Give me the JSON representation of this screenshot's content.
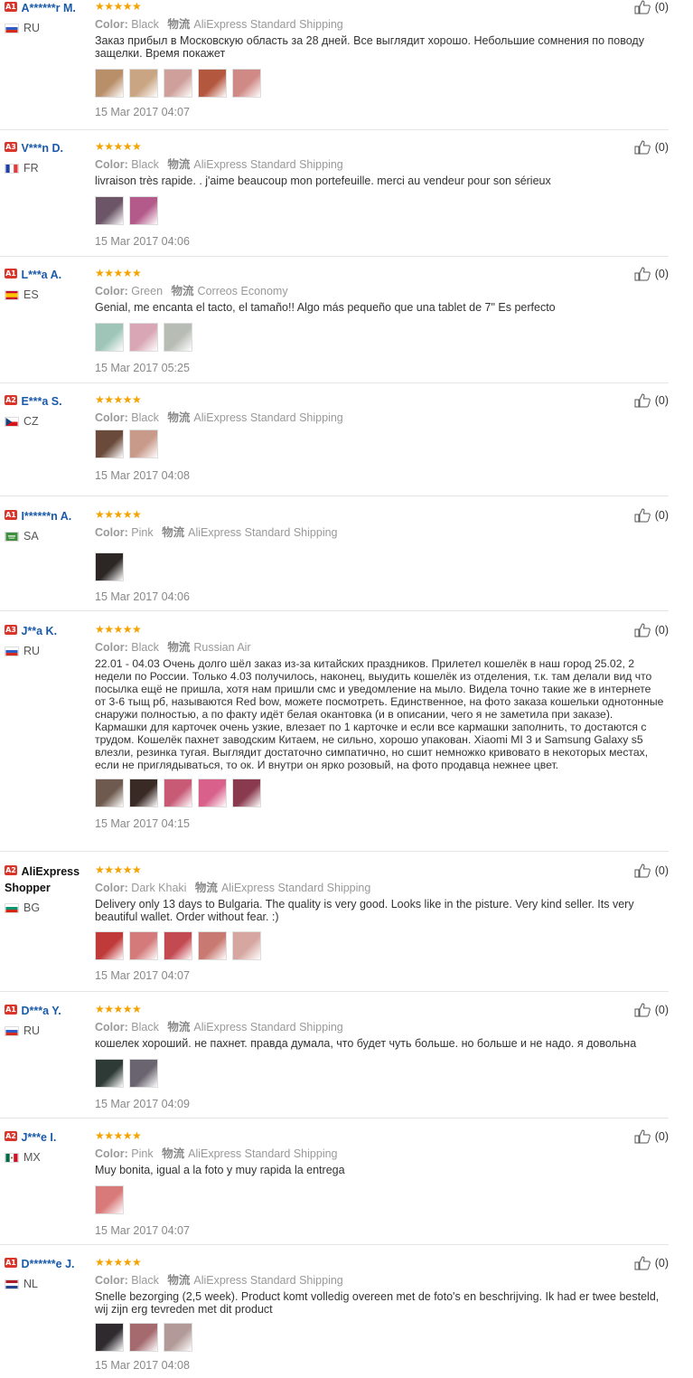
{
  "labels": {
    "color": "Color:",
    "shipping": "物流"
  },
  "reviews": [
    {
      "level": "A1",
      "name": "A******r M.",
      "country": "RU",
      "stars": "★★★★★",
      "color": "Black",
      "shipping": "AliExpress Standard Shipping",
      "text": "Заказ прибыл в Московскую область за 28 дней. Все выглядит хорошо. Небольшие сомнения по поводу защелки. Время покажет",
      "date": "15 Mar 2017 04:07",
      "helpful": "(0)",
      "thumbs": [
        "#b98f6a",
        "#c9a583",
        "#cfa09b",
        "#b4573f",
        "#d08a86"
      ]
    },
    {
      "level": "A3",
      "name": "V***n D.",
      "country": "FR",
      "stars": "★★★★★",
      "color": "Black",
      "shipping": "AliExpress Standard Shipping",
      "text": "livraison très rapide. . j'aime beaucoup mon portefeuille. merci au vendeur pour son sérieux",
      "date": "15 Mar 2017 04:06",
      "helpful": "(0)",
      "thumbs": [
        "#6b5566",
        "#b35a8a"
      ]
    },
    {
      "level": "A1",
      "name": "L***a A.",
      "country": "ES",
      "stars": "★★★★★",
      "color": "Green",
      "shipping": "Correos Economy",
      "text": "Genial, me encanta el tacto, el tamaño!! Algo más pequeño que una tablet de 7\" Es perfecto",
      "date": "15 Mar 2017 05:25",
      "helpful": "(0)",
      "thumbs": [
        "#9fc5b9",
        "#d8a6b4",
        "#b7bcb4"
      ]
    },
    {
      "level": "A2",
      "name": "E***a S.",
      "country": "CZ",
      "stars": "★★★★★",
      "color": "Black",
      "shipping": "AliExpress Standard Shipping",
      "text": "",
      "date": "15 Mar 2017 04:08",
      "helpful": "(0)",
      "thumbs": [
        "#6a4a3a",
        "#c89a8a"
      ]
    },
    {
      "level": "A1",
      "name": "I******n A.",
      "country": "SA",
      "stars": "★★★★★",
      "color": "Pink",
      "shipping": "AliExpress Standard Shipping",
      "text": "",
      "date": "15 Mar 2017 04:06",
      "helpful": "(0)",
      "thumbs": [
        "#2c2624"
      ]
    },
    {
      "level": "A3",
      "name": "J**a K.",
      "country": "RU",
      "stars": "★★★★★",
      "color": "Black",
      "shipping": "Russian Air",
      "text": "22.01 - 04.03 Очень долго шёл заказ из-за китайских праздников. Прилетел кошелёк в наш город 25.02, 2 недели по России. Только 4.03 получилось, наконец, выудить кошелёк из отделения, т.к. там делали вид что посылка ещё не пришла, хотя нам пришли смс и уведомление на мыло. Видела точно такие же в интернете от 3-6 тыщ рб, называются Red bow, можете посмотреть. Единственное, на фото заказа кошельки однотонные снаружи полностью, а по факту идёт белая окантовка (и в описании, чего я не заметила при заказе). Кармашки для карточек очень узкие, влезает по 1 карточке и если все кармашки заполнить, то достаются с трудом. Кошелёк пахнет заводским Китаем, не сильно, хорошо упакован. Xiaomi MI 3 и Samsung Galaxy s5 влезли, резинка тугая. Выглядит достаточно симпатично, но сшит немножко кривовато в некоторых местах, если не приглядываться, то ок. И внутри он ярко розовый, на фото продавца нежнее цвет.",
      "date": "15 Mar 2017 04:15",
      "helpful": "(0)",
      "thumbs": [
        "#6e5a4e",
        "#3a2a26",
        "#c85a76",
        "#d8608a",
        "#8a3a4e"
      ]
    },
    {
      "level": "A2",
      "name": "AliExpress Shopper",
      "country": "BG",
      "stars": "★★★★★",
      "color": "Dark Khaki",
      "shipping": "AliExpress Standard Shipping",
      "text": "Delivery only 13 days to Bulgaria. The quality is very good. Looks like in the pisture. Very kind seller. Its very beautiful wallet. Order without fear. :)",
      "date": "15 Mar 2017 04:07",
      "helpful": "(0)",
      "thumbs": [
        "#c03a3a",
        "#d47a7a",
        "#c44a52",
        "#c87a72",
        "#d6a6a0"
      ]
    },
    {
      "level": "A1",
      "name": "D***a Y.",
      "country": "RU",
      "stars": "★★★★★",
      "color": "Black",
      "shipping": "AliExpress Standard Shipping",
      "text": "кошелек хороший. не пахнет. правда думала, что будет чуть больше. но больше и не надо. я довольна",
      "date": "15 Mar 2017 04:09",
      "helpful": "(0)",
      "thumbs": [
        "#2e3a36",
        "#6a6470"
      ]
    },
    {
      "level": "A2",
      "name": "J***e I.",
      "country": "MX",
      "stars": "★★★★★",
      "color": "Pink",
      "shipping": "AliExpress Standard Shipping",
      "text": "Muy bonita, igual a la foto y muy rapida la entrega",
      "date": "15 Mar 2017 04:07",
      "helpful": "(0)",
      "thumbs": [
        "#d97a7a"
      ]
    },
    {
      "level": "A1",
      "name": "D******e J.",
      "country": "NL",
      "stars": "★★★★★",
      "color": "Black",
      "shipping": "AliExpress Standard Shipping",
      "text": "Snelle bezorging (2,5 week). Product komt volledig overeen met de foto's en beschrijving. Ik had er twee besteld, wij zijn erg tevreden met dit product",
      "date": "15 Mar 2017 04:08",
      "helpful": "(0)",
      "thumbs": [
        "#2e2a2e",
        "#a46a6e",
        "#b29a98"
      ]
    }
  ]
}
